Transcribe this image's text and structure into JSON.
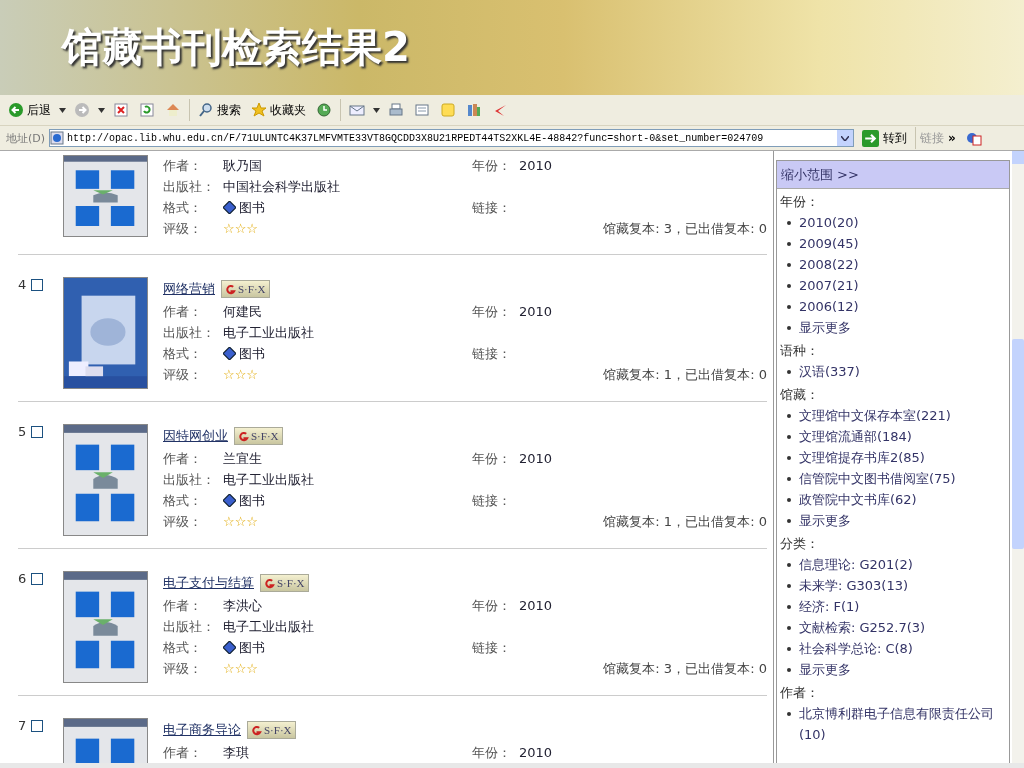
{
  "slide_title": "馆藏书刊检索结果2",
  "toolbar": [
    {
      "kind": "back",
      "label": "后退",
      "dropdown": true
    },
    {
      "kind": "forward",
      "dropdown": true
    },
    {
      "kind": "stop"
    },
    {
      "kind": "refresh"
    },
    {
      "kind": "home"
    },
    {
      "kind": "separator"
    },
    {
      "kind": "search",
      "label": "搜索"
    },
    {
      "kind": "favorites",
      "label": "收藏夹"
    },
    {
      "kind": "history"
    },
    {
      "kind": "separator"
    },
    {
      "kind": "mail",
      "dropdown": true
    },
    {
      "kind": "print"
    },
    {
      "kind": "edit"
    },
    {
      "kind": "note"
    },
    {
      "kind": "research"
    },
    {
      "kind": "messenger"
    }
  ],
  "address": {
    "label": "地址(D)",
    "url": "http://opac.lib.whu.edu.cn/F/71ULUNTC4K37LMFVMTE33VT8GQCDD3X8U21RPEDT44TS2XKL4E-48842?func=short-0&set_number=024709",
    "go": "转到",
    "links": "链接",
    "more": "»"
  },
  "records": [
    {
      "author": {
        "label": "作者：",
        "value": "耿乃国"
      },
      "publisher": {
        "label": "出版社：",
        "value": "中国社会科学出版社"
      },
      "format": {
        "label": "格式：",
        "value": "图书"
      },
      "rating": {
        "label": "评级：",
        "value": "☆☆☆"
      },
      "year": {
        "label": "年份：",
        "value": "2010"
      },
      "link": {
        "label": "链接："
      },
      "holdings": "馆藏复本: 3，已出借复本: 0"
    },
    {
      "number": "4",
      "checked": false,
      "title": "网络营销",
      "badge": "S·F·X",
      "author": {
        "label": "作者：",
        "value": "何建民"
      },
      "publisher": {
        "label": "出版社：",
        "value": "电子工业出版社"
      },
      "format": {
        "label": "格式：",
        "value": "图书"
      },
      "rating": {
        "label": "评级：",
        "value": "☆☆☆"
      },
      "year": {
        "label": "年份：",
        "value": "2010"
      },
      "link": {
        "label": "链接："
      },
      "holdings": "馆藏复本: 1，已出借复本: 0"
    },
    {
      "number": "5",
      "checked": false,
      "title": "因特网创业",
      "badge": "S·F·X",
      "author": {
        "label": "作者：",
        "value": "兰宜生"
      },
      "publisher": {
        "label": "出版社：",
        "value": "电子工业出版社"
      },
      "format": {
        "label": "格式：",
        "value": "图书"
      },
      "rating": {
        "label": "评级：",
        "value": "☆☆☆"
      },
      "year": {
        "label": "年份：",
        "value": "2010"
      },
      "link": {
        "label": "链接："
      },
      "holdings": "馆藏复本: 1，已出借复本: 0"
    },
    {
      "number": "6",
      "checked": false,
      "title": "电子支付与结算",
      "badge": "S·F·X",
      "author": {
        "label": "作者：",
        "value": "李洪心"
      },
      "publisher": {
        "label": "出版社：",
        "value": "电子工业出版社"
      },
      "format": {
        "label": "格式：",
        "value": "图书"
      },
      "rating": {
        "label": "评级：",
        "value": "☆☆☆"
      },
      "year": {
        "label": "年份：",
        "value": "2010"
      },
      "link": {
        "label": "链接："
      },
      "holdings": "馆藏复本: 3，已出借复本: 0"
    },
    {
      "number": "7",
      "checked": false,
      "title": "电子商务导论",
      "badge": "S·F·X",
      "author": {
        "label": "作者：",
        "value": "李琪"
      },
      "year": {
        "label": "年份：",
        "value": "2010"
      }
    }
  ],
  "sidebar": {
    "header": "缩小范围 >>",
    "groups": [
      {
        "label": "年份：",
        "items": [
          "2010(20)",
          "2009(45)",
          "2008(22)",
          "2007(21)",
          "2006(12)",
          "显示更多"
        ]
      },
      {
        "label": "语种：",
        "items": [
          "汉语(337)"
        ]
      },
      {
        "label": "馆藏：",
        "items": [
          "文理馆中文保存本室(221)",
          "文理馆流通部(184)",
          "文理馆提存书库2(85)",
          "信管院中文图书借阅室(75)",
          "政管院中文书库(62)",
          "显示更多"
        ]
      },
      {
        "label": "分类：",
        "items": [
          "信息理论: G201(2)",
          "未来学: G303(13)",
          "经济: F(1)",
          "文献检索: G252.7(3)",
          "社会科学总论: C(8)",
          "显示更多"
        ]
      },
      {
        "label": "作者：",
        "items": [
          "北京博利群电子信息有限责任公司(10)"
        ]
      }
    ]
  }
}
